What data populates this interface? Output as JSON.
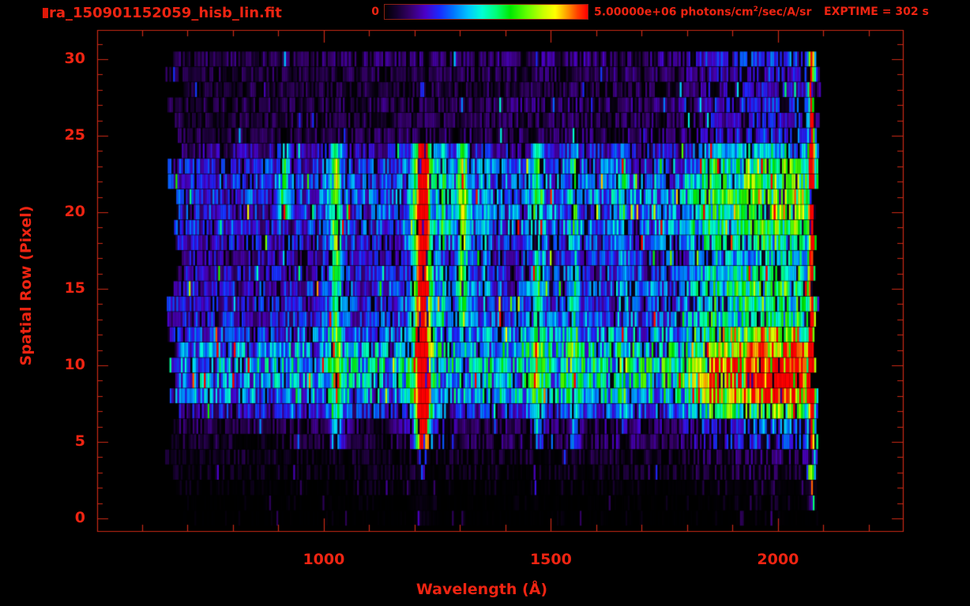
{
  "header": {
    "title": "ra_150901152059_hisb_lin.fit",
    "colorbar": {
      "min_label": "0",
      "max_prefix": "5.00000e+06 photons/cm",
      "max_sup": "2",
      "max_suffix": "/sec/A/sr"
    },
    "exptime": "EXPTIME = 302 s"
  },
  "axes": {
    "x": {
      "label": "Wavelength (Å)",
      "ticks": [
        {
          "value": 1000,
          "label": "1000"
        },
        {
          "value": 1500,
          "label": "1500"
        },
        {
          "value": 2000,
          "label": "2000"
        }
      ],
      "minor_step": 100
    },
    "y": {
      "label": "Spatial Row (Pixel)",
      "ticks": [
        {
          "value": 0,
          "label": "0"
        },
        {
          "value": 5,
          "label": "5"
        },
        {
          "value": 10,
          "label": "10"
        },
        {
          "value": 15,
          "label": "15"
        },
        {
          "value": 20,
          "label": "20"
        },
        {
          "value": 25,
          "label": "25"
        },
        {
          "value": 30,
          "label": "30"
        }
      ],
      "minor_step": 1
    }
  },
  "colors": {
    "text_red": "#ee2412",
    "frame_red": "#cc2a16",
    "background": "#000000"
  },
  "chart_data": {
    "type": "heatmap",
    "title": "ra_150901152059_hisb_lin.fit",
    "xlabel": "Wavelength (Å)",
    "ylabel": "Spatial Row (Pixel)",
    "x_range": [
      501,
      2275
    ],
    "y_range": [
      -0.82,
      31.91
    ],
    "color_scale": {
      "min": 0,
      "max": 5000000,
      "units": "photons/cm^2/sec/A/sr"
    },
    "exposure_time_s": 302,
    "data_extent": {
      "wavelength_min": 650,
      "wavelength_max": 2092,
      "row_min": 0,
      "row_max": 30
    },
    "row_base": [
      0.02,
      0.025,
      0.04,
      0.06,
      0.07,
      0.11,
      0.13,
      0.26,
      0.4,
      0.44,
      0.46,
      0.42,
      0.34,
      0.28,
      0.26,
      0.28,
      0.24,
      0.22,
      0.26,
      0.3,
      0.3,
      0.32,
      0.3,
      0.28,
      0.2,
      0.12,
      0.11,
      0.12,
      0.1,
      0.11,
      0.13
    ],
    "row_dropout": [
      0.93,
      0.9,
      0.8,
      0.6,
      0.55,
      0.35,
      0.3,
      0.12,
      0.06,
      0.05,
      0.05,
      0.06,
      0.08,
      0.1,
      0.12,
      0.1,
      0.14,
      0.16,
      0.12,
      0.1,
      0.1,
      0.08,
      0.1,
      0.12,
      0.15,
      0.3,
      0.3,
      0.28,
      0.32,
      0.3,
      0.25
    ],
    "bump_profile": [
      0.0,
      0.02,
      0.05,
      0.05,
      0.06,
      0.12,
      0.15,
      0.3,
      0.42,
      0.46,
      0.46,
      0.42,
      0.32,
      0.22,
      0.2,
      0.22,
      0.18,
      0.16,
      0.2,
      0.24,
      0.26,
      0.28,
      0.26,
      0.22,
      0.16,
      0.1,
      0.09,
      0.1,
      0.08,
      0.09,
      0.1
    ],
    "continuum_bump": {
      "wl_start": 1780,
      "wl_end": 2058,
      "note": "broad long-wavelength band, brightest rows 8-11 (yellow 1930-2045)"
    },
    "emission_lines": [
      {
        "wl": 912,
        "sigma": 7,
        "amp": 0.3,
        "row_min": 20,
        "row_max": 24
      },
      {
        "wl": 1025,
        "sigma": 7,
        "amp": 0.4,
        "row_min": 5,
        "row_max": 24
      },
      {
        "wl": 1216,
        "sigma": 9,
        "amp": 1.15,
        "row_min": 5,
        "row_max": 24,
        "below_factor": 0.18
      },
      {
        "wl": 1260,
        "sigma": 5,
        "amp": 0.18,
        "row_min": 13,
        "row_max": 24
      },
      {
        "wl": 1304,
        "sigma": 7,
        "amp": 0.42,
        "row_min": 13,
        "row_max": 24
      },
      {
        "wl": 1356,
        "sigma": 5,
        "amp": 0.15,
        "row_min": 13,
        "row_max": 24
      },
      {
        "wl": 1470,
        "sigma": 7,
        "amp": 0.28,
        "row_min": 5,
        "row_max": 24
      },
      {
        "wl": 1550,
        "sigma": 6,
        "amp": 0.2,
        "row_min": 5,
        "row_max": 24
      },
      {
        "wl": 1657,
        "sigma": 6,
        "amp": 0.16,
        "row_min": 5,
        "row_max": 24
      },
      {
        "wl": 2072,
        "sigma": 4,
        "amp": 0.95,
        "row_min": 1,
        "row_max": 30
      }
    ],
    "colormap_stops": [
      [
        0.0,
        "#000000"
      ],
      [
        0.06,
        "#16002e"
      ],
      [
        0.13,
        "#38006e"
      ],
      [
        0.2,
        "#4a00c8"
      ],
      [
        0.27,
        "#1a2aff"
      ],
      [
        0.34,
        "#0077ff"
      ],
      [
        0.41,
        "#00c4ff"
      ],
      [
        0.48,
        "#00ffd4"
      ],
      [
        0.55,
        "#00ff78"
      ],
      [
        0.62,
        "#00e800"
      ],
      [
        0.7,
        "#63ff00"
      ],
      [
        0.78,
        "#c8ff00"
      ],
      [
        0.84,
        "#ffff00"
      ],
      [
        0.9,
        "#ff9900"
      ],
      [
        0.95,
        "#ff4000"
      ],
      [
        1.0,
        "#ff0000"
      ]
    ],
    "legend_position": "top",
    "grid": false
  }
}
